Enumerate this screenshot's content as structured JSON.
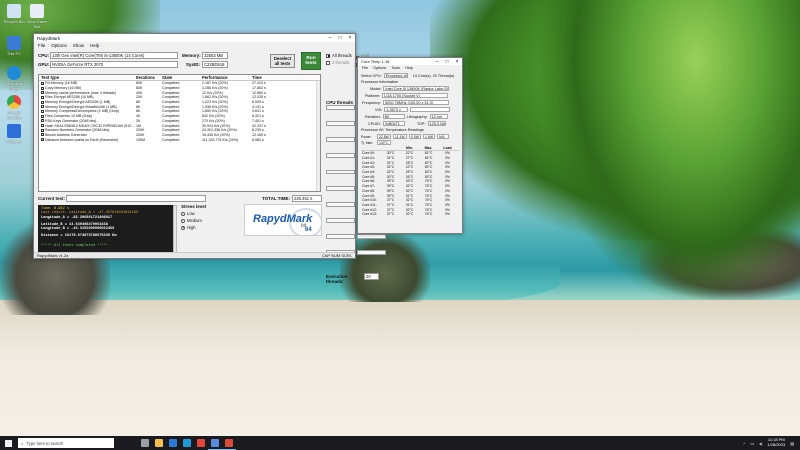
{
  "desktop": {
    "icons": [
      {
        "label": "Recycle Bin",
        "color": "#cfe3f5"
      },
      {
        "label": "Xbox Game Bar",
        "color": "#e8eef5"
      },
      {
        "label": "This PC",
        "color": "#3a7bd5"
      },
      {
        "label": "Microsoft Edge",
        "color": "#1f8ad8"
      },
      {
        "label": "Google Chrome",
        "color": "#e5483b"
      },
      {
        "label": "Phoenix",
        "color": "#2d6fd6"
      }
    ]
  },
  "rapydmark": {
    "title": "RapydMark",
    "menu": [
      "File",
      "Options",
      "Show",
      "Help"
    ],
    "cpu_label": "CPU:",
    "cpu_value": "13th Gen Intel(R) Core(TM) i5-13600K (14 Cores)",
    "gpu_label": "GPU:",
    "gpu_value": "NVIDIA GeForce RTX 3070",
    "memory_label": "Memory:",
    "memory_value": "32553 MB",
    "sysid_label": "SysID:",
    "sysid_value": "C22BD518",
    "deselect_label": "Deselect all tests",
    "run_label": "Run tests",
    "threads": {
      "all": "All threads",
      "half": "Half threads",
      "two": "2 threads",
      "four": "4 threads"
    },
    "columns": [
      "Test type",
      "Iterations",
      "State",
      "Performance",
      "Time"
    ],
    "tests": [
      {
        "name": "Fill Memory (16 MB)",
        "iter": "80K",
        "state": "Completed",
        "perf": "2,187 K/s (20%)",
        "time": "27.424 s"
      },
      {
        "name": "Copy Memory (16 MB)",
        "iter": "60K",
        "state": "Completed",
        "perf": "3,358 K/s (20%)",
        "time": "17.863 s"
      },
      {
        "name": "Memory cache performance (max 4 threads)",
        "iter": "40K",
        "state": "Completed",
        "perf": "12 K/s (20%)",
        "time": "12.684 s"
      },
      {
        "name": "Files Encrypt AES256 (10 MB)",
        "iter": "20K",
        "state": "Completed",
        "perf": "1,662 K/s (20%)",
        "time": "12.035 s"
      },
      {
        "name": "Memory Encrypt/Decrypt AES256 (1 MB)",
        "iter": "8K",
        "state": "Completed",
        "perf": "1,223 K/s (20%)",
        "time": "6.539 s"
      },
      {
        "name": "Memory Encrypt/Decrypt Blowfish448 (1 MB)",
        "iter": "8K",
        "state": "Completed",
        "perf": "1,936 K/s (20%)",
        "time": "4.131 s"
      },
      {
        "name": "Memory Compress/Decompress (1 MB) (Gzip)",
        "iter": "8K",
        "state": "Completed",
        "perf": "1,850 K/s (20%)",
        "time": "4.641 s"
      },
      {
        "name": "Files Compress 10 MB (Gzip)",
        "iter": "4K",
        "state": "Completed",
        "perf": "632 K/s (20%)",
        "time": "6.321 s"
      },
      {
        "name": "RSA Keys Generator (2048 bits)",
        "iter": "2K",
        "state": "Completed",
        "perf": "270 K/s (20%)",
        "time": "7.401 s"
      },
      {
        "name": "Hash SHA1/256/512 MD4/5 CRC32 RIPEMD160 (512 ...",
        "iter": "1M",
        "state": "Completed",
        "perf": "30,924 K/s (20%)",
        "time": "32.337 s"
      },
      {
        "name": "Random Numbers Generator (2048 bits)",
        "iter": "200K",
        "state": "Completed",
        "perf": "24,301,336 K/s (20%)",
        "time": "8.230 s"
      },
      {
        "name": "Bitcoin Address Generator",
        "iter": "200K",
        "state": "Completed",
        "perf": "16,435 K/s (20%)",
        "time": "12.169 s"
      },
      {
        "name": "Distance between points on Earth (Haversine)",
        "iter": "100M",
        "state": "Completed",
        "perf": "111,333,776 K/s (20%)",
        "time": "8.982 s"
      }
    ],
    "cpu_threads_label": "CPU threads ( 20 )",
    "current_test_label": "Current test:",
    "current_test_value": "",
    "total_time_label": "TOTAL TIME:",
    "total_time_value": "226.461 s",
    "console": {
      "time": "Time: 8.982 s",
      "last_result": "Last result:  Latitude_A = -47.457816441614163",
      "lon_a": "Longitude_A = -82.206861721408817",
      "lat_b": "Latitude_B = 14.640408479063438",
      "lon_b": "Longitude_B = -16.3155000900562450",
      "distance": "Distance = 16178.074873780675339 Km",
      "done": "***** All tests completed *****"
    },
    "stress_title": "Stress level",
    "stress_options": [
      "Low",
      "Medium",
      "High"
    ],
    "stress_selected": "High",
    "logo_text": "RapydMark",
    "logo_bit": "bit",
    "logo_64": "64",
    "exec_threads_label": "Execution threads:",
    "exec_threads_value": "20",
    "status_left": "RapydMark v1.2a",
    "status_right": "CAP  NUM  SCRL"
  },
  "coretemp": {
    "title": "Core Temp 1.18",
    "menu": [
      "File",
      "Options",
      "Tools",
      "Help"
    ],
    "select_cpu_label": "Select CPU:",
    "select_cpu_value": "Processor #0",
    "cores_value": "14 Core(s)",
    "threads_value": "20 Thread(s)",
    "proc_info_label": "Processor Information",
    "model_label": "Model:",
    "model_value": "Intel Core i5 13600K (Raptor Lake-S)",
    "platform_label": "Platform:",
    "platform_value": "LGA 1700 (Socket V)",
    "freq_label": "Frequency:",
    "freq_value": "5000.78MHz (100.00 x 51.0)",
    "vid_label": "VID:",
    "vid_value": "1.3573 v",
    "revision_label": "Revision:",
    "revision_value": "B0",
    "litho_label": "Lithography:",
    "litho_value": "10 nm",
    "cpuid_label": "CPUID:",
    "cpuid_value": "0xB0671",
    "tdp_label": "TDP:",
    "tdp_value": "125.0 Watts",
    "temp_header": "Processor #0: Temperature Readings",
    "temp_columns": [
      "",
      "Min.",
      "Max.",
      "Load"
    ],
    "power_row": [
      "Power:",
      "22.8W",
      "11.1W",
      "0.0W",
      "1.6W",
      "N/A"
    ],
    "tjmax_row": [
      "Tj. Max:",
      "100°C"
    ],
    "cores": [
      {
        "name": "Core #0:",
        "cur": "30°C",
        "min": "22°C",
        "max": "81°C",
        "load": "0%"
      },
      {
        "name": "Core #1:",
        "cur": "31°C",
        "min": "27°C",
        "max": "84°C",
        "load": "0%"
      },
      {
        "name": "Core #2:",
        "cur": "31°C",
        "min": "28°C",
        "max": "82°C",
        "load": "0%"
      },
      {
        "name": "Core #3:",
        "cur": "32°C",
        "min": "22°C",
        "max": "84°C",
        "load": "0%"
      },
      {
        "name": "Core #4:",
        "cur": "32°C",
        "min": "25°C",
        "max": "83°C",
        "load": "0%"
      },
      {
        "name": "Core #5:",
        "cur": "30°C",
        "min": "26°C",
        "max": "83°C",
        "load": "0%"
      },
      {
        "name": "Core #6:",
        "cur": "39°C",
        "min": "33°C",
        "max": "76°C",
        "load": "0%"
      },
      {
        "name": "Core #7:",
        "cur": "39°C",
        "min": "32°C",
        "max": "76°C",
        "load": "0%"
      },
      {
        "name": "Core #8:",
        "cur": "39°C",
        "min": "32°C",
        "max": "76°C",
        "load": "0%"
      },
      {
        "name": "Core #9:",
        "cur": "39°C",
        "min": "31°C",
        "max": "76°C",
        "load": "0%"
      },
      {
        "name": "Core #10:",
        "cur": "37°C",
        "min": "32°C",
        "max": "76°C",
        "load": "0%"
      },
      {
        "name": "Core #11:",
        "cur": "37°C",
        "min": "31°C",
        "max": "76°C",
        "load": "0%"
      },
      {
        "name": "Core #12:",
        "cur": "37°C",
        "min": "32°C",
        "max": "76°C",
        "load": "0%"
      },
      {
        "name": "Core #13:",
        "cur": "37°C",
        "min": "32°C",
        "max": "76°C",
        "load": "0%"
      }
    ]
  },
  "taskbar": {
    "search_placeholder": "Type here to search",
    "apps": [
      {
        "name": "task-view",
        "color": "#9aa0a8"
      },
      {
        "name": "file-explorer",
        "color": "#f2c14a"
      },
      {
        "name": "mail",
        "color": "#2a7ad6"
      },
      {
        "name": "edge",
        "color": "#1f9ad8"
      },
      {
        "name": "chrome",
        "color": "#e2453b"
      },
      {
        "name": "store",
        "color": "#5a8ae0"
      },
      {
        "name": "rapydmark",
        "color": "#d84a3a"
      }
    ],
    "time": "11:18 PM",
    "date": "1/28/2023"
  }
}
